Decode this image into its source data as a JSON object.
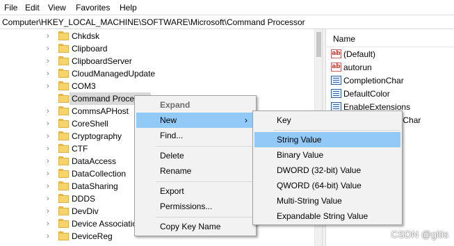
{
  "menubar": {
    "items": [
      "File",
      "Edit",
      "View",
      "Favorites",
      "Help"
    ]
  },
  "address": {
    "path": "Computer\\HKEY_LOCAL_MACHINE\\SOFTWARE\\Microsoft\\Command Processor"
  },
  "tree": {
    "items": [
      {
        "label": "Chkdsk"
      },
      {
        "label": "Clipboard"
      },
      {
        "label": "ClipboardServer"
      },
      {
        "label": "CloudManagedUpdate"
      },
      {
        "label": "COM3"
      },
      {
        "label": "Command Processor",
        "selected": true
      },
      {
        "label": "CommsAPHost"
      },
      {
        "label": "CoreShell"
      },
      {
        "label": "Cryptography"
      },
      {
        "label": "CTF"
      },
      {
        "label": "DataAccess"
      },
      {
        "label": "DataCollection"
      },
      {
        "label": "DataSharing"
      },
      {
        "label": "DDDS"
      },
      {
        "label": "DevDiv"
      },
      {
        "label": "Device Association"
      },
      {
        "label": "DeviceReg"
      }
    ]
  },
  "values": {
    "header": "Name",
    "items": [
      {
        "label": "(Default)",
        "icon": "string-value-icon"
      },
      {
        "label": "autorun",
        "icon": "string-value-icon"
      },
      {
        "label": "CompletionChar",
        "icon": "binary-value-icon"
      },
      {
        "label": "DefaultColor",
        "icon": "binary-value-icon"
      },
      {
        "label": "EnableExtensions",
        "icon": "binary-value-icon"
      },
      {
        "label": "PathCompletionChar",
        "icon": "binary-value-icon"
      }
    ]
  },
  "context_menu": {
    "expand": "Expand",
    "new": "New",
    "find": "Find...",
    "delete": "Delete",
    "rename": "Rename",
    "export": "Export",
    "permissions": "Permissions...",
    "copy_key_name": "Copy Key Name"
  },
  "submenu": {
    "key": "Key",
    "string_value": "String Value",
    "binary_value": "Binary Value",
    "dword_value": "DWORD (32-bit) Value",
    "qword_value": "QWORD (64-bit) Value",
    "multi_string_value": "Multi-String Value",
    "expandable_string_value": "Expandable String Value"
  },
  "watermark": "CSDN @gitis",
  "colors": {
    "highlight": "#91c9f7",
    "menu_bg": "#f2f2f2",
    "folder": "#f7d36b"
  }
}
